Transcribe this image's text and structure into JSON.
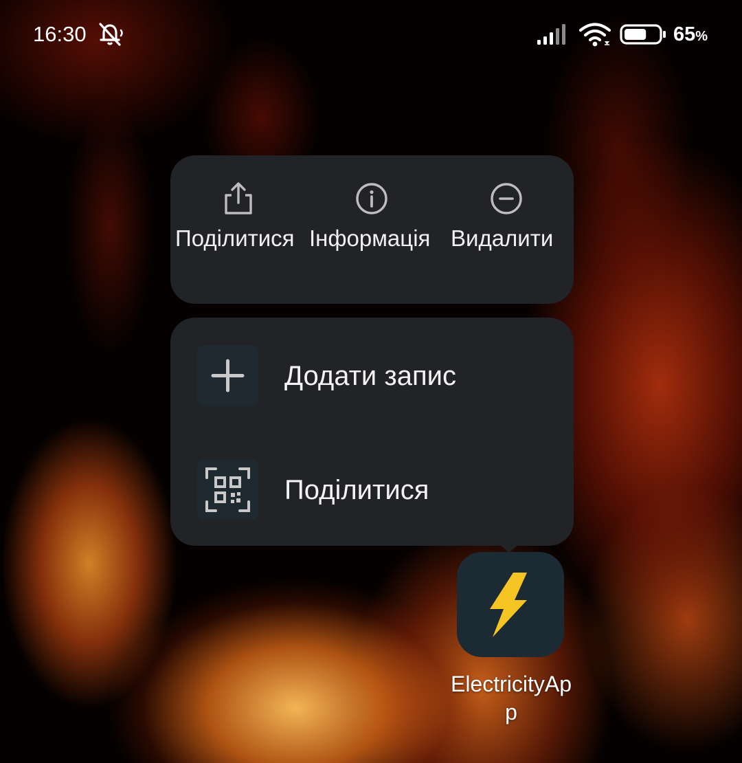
{
  "status_bar": {
    "time": "16:30",
    "battery_percent": "65",
    "battery_unit": "%",
    "battery_level": 0.65,
    "signal_icon": "cellular-signal-icon",
    "wifi_icon": "wifi-icon",
    "notification_icon": "bell-off-icon"
  },
  "popup": {
    "actions": [
      {
        "label": "Поділитися",
        "icon": "share-icon"
      },
      {
        "label": "Інформація",
        "icon": "info-icon"
      },
      {
        "label": "Видалити",
        "icon": "remove-icon"
      }
    ],
    "shortcuts": [
      {
        "label": "Додати запис",
        "icon": "plus-icon"
      },
      {
        "label": "Поділитися",
        "icon": "qr-code-icon"
      }
    ]
  },
  "app": {
    "label": "ElectricityApp",
    "icon": "lightning-bolt-icon",
    "bolt_color": "#f5c623",
    "icon_background": "#1b2a33"
  },
  "colors": {
    "card_background": "#222327",
    "icon_gray": "#bdbdbd"
  }
}
